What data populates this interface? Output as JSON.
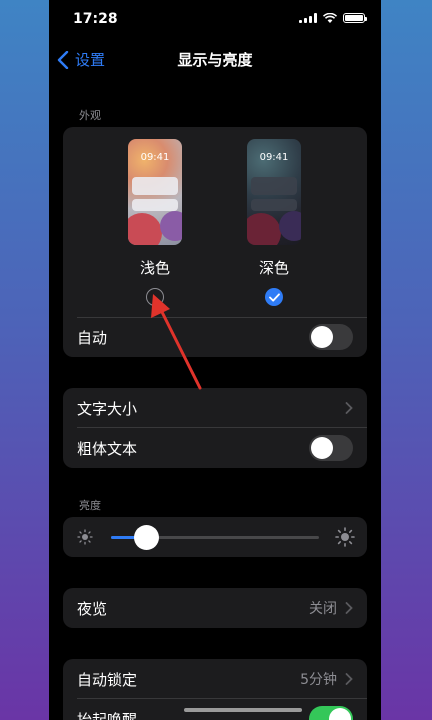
{
  "status_bar": {
    "time": "17:28"
  },
  "nav": {
    "back_label": "设置",
    "title": "显示与亮度"
  },
  "appearance": {
    "section_label": "外观",
    "modes": [
      {
        "name": "浅色",
        "preview_time": "09:41",
        "selected": false
      },
      {
        "name": "深色",
        "preview_time": "09:41",
        "selected": true
      }
    ],
    "auto_label": "自动",
    "auto_toggle": false
  },
  "text": {
    "text_size_label": "文字大小",
    "bold_text_label": "粗体文本",
    "bold_toggle": false
  },
  "brightness": {
    "section_label": "亮度",
    "level": 0.17
  },
  "night_shift": {
    "label": "夜览",
    "value": "关闭"
  },
  "lock": {
    "auto_lock_label": "自动锁定",
    "auto_lock_value": "5分钟",
    "raise_to_wake_label": "抬起唤醒",
    "raise_to_wake_toggle": true
  },
  "colors": {
    "accent": "#2f7cf6",
    "toggle_on": "#34c759",
    "annotation_arrow": "#e0332b"
  }
}
